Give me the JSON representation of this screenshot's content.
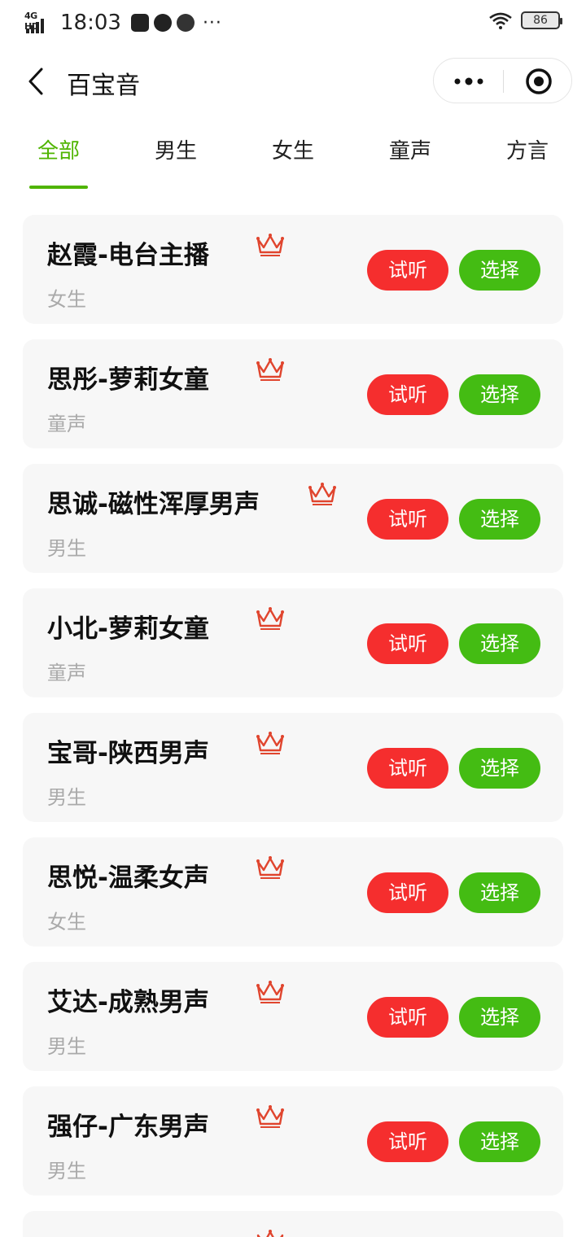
{
  "status_bar": {
    "network": "4G HD",
    "time": "18:03",
    "more": "···",
    "battery": "86"
  },
  "nav": {
    "title": "百宝音"
  },
  "tabs": [
    "全部",
    "男生",
    "女生",
    "童声",
    "方言"
  ],
  "active_tab": 0,
  "buttons": {
    "listen": "试听",
    "select": "选择"
  },
  "voices": [
    {
      "name": "赵霞-电台主播",
      "category": "女生"
    },
    {
      "name": "思彤-萝莉女童",
      "category": "童声"
    },
    {
      "name": "思诚-磁性浑厚男声",
      "category": "男生"
    },
    {
      "name": "小北-萝莉女童",
      "category": "童声"
    },
    {
      "name": "宝哥-陕西男声",
      "category": "男生"
    },
    {
      "name": "思悦-温柔女声",
      "category": "女生"
    },
    {
      "name": "艾达-成熟男声",
      "category": "男生"
    },
    {
      "name": "强仔-广东男声",
      "category": "男生"
    }
  ],
  "colors": {
    "accent_green": "#4fb400",
    "listen_red": "#f52e2e",
    "select_green": "#44bc13",
    "crown_red": "#e0452e"
  }
}
